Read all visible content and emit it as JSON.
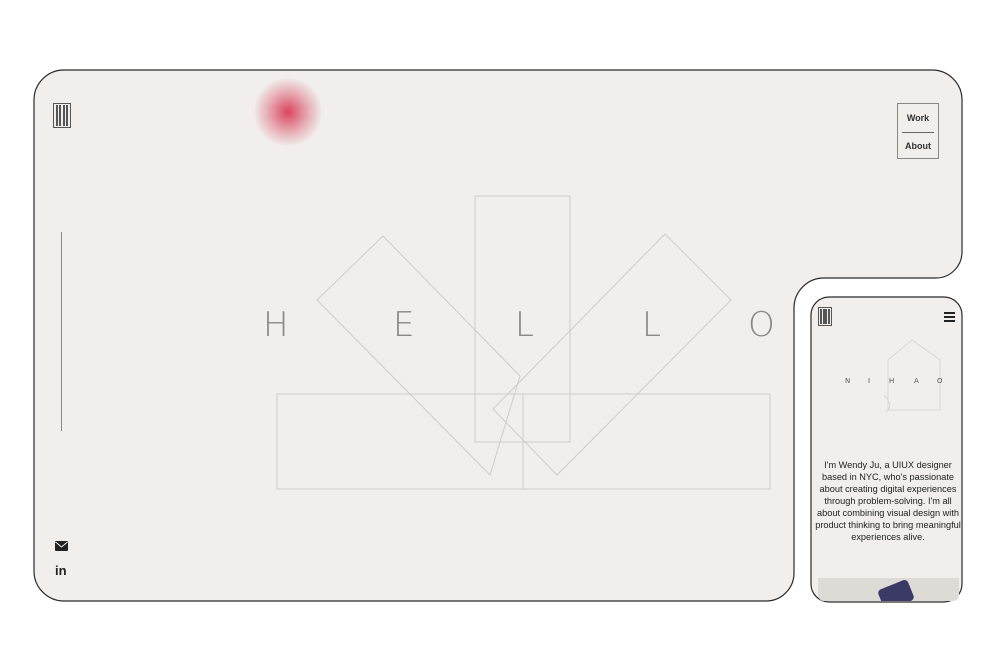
{
  "desktop": {
    "nav": {
      "work_label": "Work",
      "about_label": "About"
    },
    "hello_letters": [
      "H",
      "E",
      "L",
      "L",
      "O"
    ],
    "social": {
      "linkedin_label": "in"
    },
    "icons": {
      "logo": "logo-bars-icon",
      "mail": "mail-icon",
      "linkedin": "linkedin-icon"
    },
    "accent_color": "#d62846"
  },
  "mobile": {
    "nihao_letters": [
      "N",
      "I",
      "H",
      "A",
      "O"
    ],
    "bio": "I'm Wendy Ju, a UIUX designer based in NYC, who's passionate about creating digital experiences through problem-solving. I'm all about combining visual design with product thinking to bring meaningful experiences alive.",
    "icons": {
      "menu": "hamburger-menu-icon",
      "logo": "logo-bars-icon"
    }
  },
  "colors": {
    "background": "#f1eeeb",
    "text": "#222222",
    "hello": "#8b8783"
  }
}
